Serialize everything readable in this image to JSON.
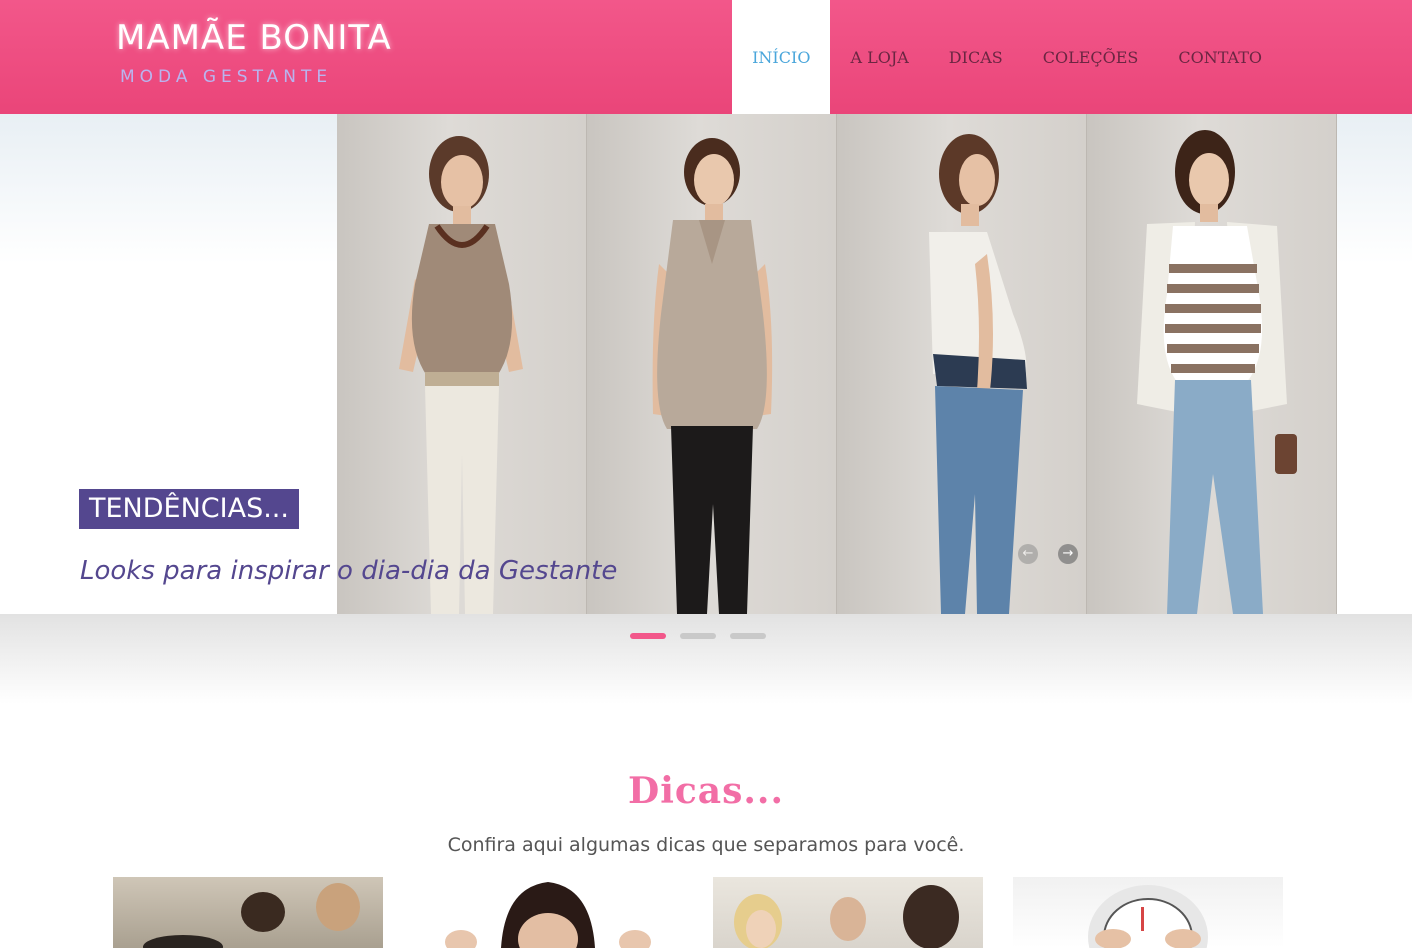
{
  "header": {
    "logo": {
      "top": "MAMÃE BONITA",
      "bottom": "MODA GESTANTE"
    },
    "nav": [
      {
        "label": "INÍCIO",
        "active": true
      },
      {
        "label": "A LOJA",
        "active": false
      },
      {
        "label": "DICAS",
        "active": false
      },
      {
        "label": "COLEÇÕES",
        "active": false
      },
      {
        "label": "CONTATO",
        "active": false
      }
    ]
  },
  "hero": {
    "tag": "TENDÊNCIAS...",
    "caption": "Looks para inspirar o dia-dia da Gestante",
    "prev_icon": "arrow-left-icon",
    "next_icon": "arrow-right-icon",
    "prev_glyph": "←",
    "next_glyph": "→",
    "slides_total": 3,
    "slide_active": 1
  },
  "dicas": {
    "title": "Dicas...",
    "subtitle": "Confira aqui algumas dicas que separamos para você."
  },
  "colors": {
    "brand_pink": "#f2578a",
    "nav_active_text": "#4aa6db",
    "tag_purple": "#54478f",
    "title_pink": "#f26ea6"
  }
}
